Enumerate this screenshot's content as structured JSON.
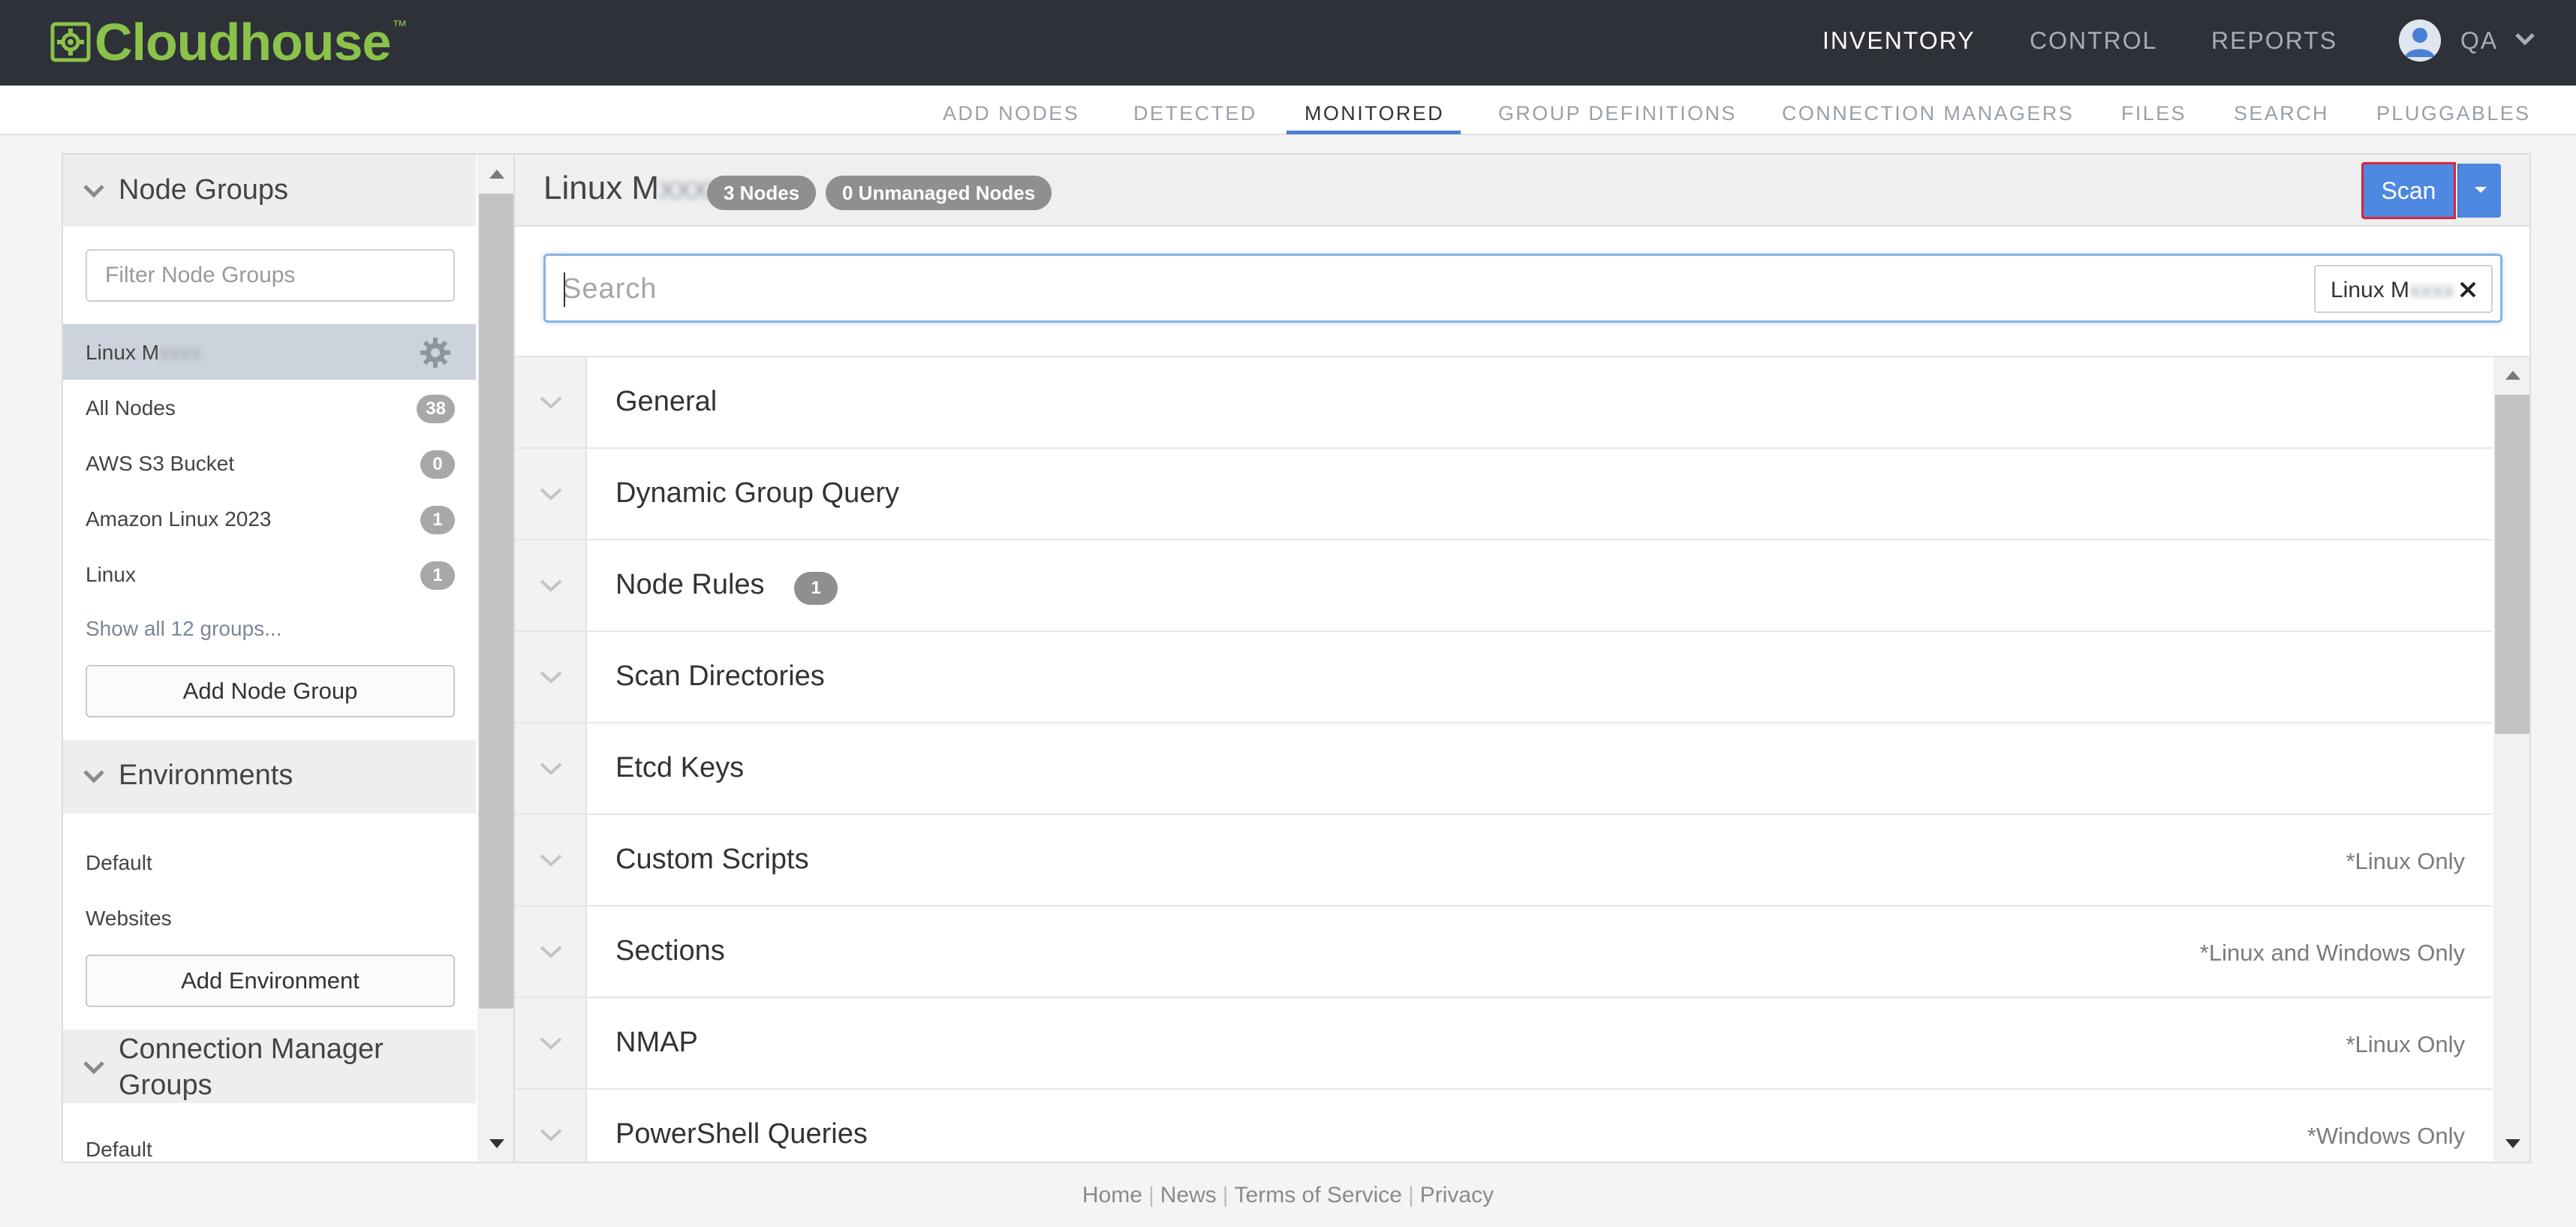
{
  "brand": {
    "name": "Cloudhouse",
    "tm": "™",
    "color": "#8bc34a"
  },
  "main_nav": {
    "items": [
      "INVENTORY",
      "CONTROL",
      "REPORTS"
    ],
    "active": "INVENTORY",
    "user_label": "QA"
  },
  "sub_nav": {
    "items": [
      "ADD NODES",
      "DETECTED",
      "MONITORED",
      "GROUP DEFINITIONS",
      "CONNECTION MANAGERS",
      "FILES",
      "SEARCH",
      "PLUGGABLES"
    ],
    "active": "MONITORED",
    "accent": "#4a7fd6"
  },
  "sidebar": {
    "node_groups": {
      "heading": "Node Groups",
      "filter_placeholder": "Filter Node Groups",
      "selected": {
        "label_visible": "Linux M",
        "label_blurred": "xxxx"
      },
      "items": [
        {
          "label": "All Nodes",
          "count": "38"
        },
        {
          "label": "AWS S3 Bucket",
          "count": "0"
        },
        {
          "label": "Amazon Linux 2023",
          "count": "1"
        },
        {
          "label": "Linux",
          "count": "1"
        }
      ],
      "show_all": "Show all 12 groups...",
      "add_button": "Add Node Group"
    },
    "environments": {
      "heading": "Environments",
      "items": [
        "Default",
        "Websites"
      ],
      "add_button": "Add Environment"
    },
    "connection_manager_groups": {
      "heading_line1": "Connection Manager",
      "heading_line2": "Groups",
      "items": [
        "Default"
      ]
    }
  },
  "main": {
    "title_visible": "Linux M",
    "title_blurred": "xxxx",
    "nodes_pill": "3 Nodes",
    "unmanaged_pill": "0 Unmanaged Nodes",
    "scan_button": "Scan",
    "search_placeholder": "Search",
    "chip_visible": "Linux M",
    "chip_blurred": "xxxx",
    "sections": [
      {
        "title": "General",
        "note": "",
        "badge": ""
      },
      {
        "title": "Dynamic Group Query",
        "note": "",
        "badge": ""
      },
      {
        "title": "Node Rules",
        "note": "",
        "badge": "1"
      },
      {
        "title": "Scan Directories",
        "note": "",
        "badge": ""
      },
      {
        "title": "Etcd Keys",
        "note": "",
        "badge": ""
      },
      {
        "title": "Custom Scripts",
        "note": "*Linux Only",
        "badge": ""
      },
      {
        "title": "Sections",
        "note": "*Linux and Windows Only",
        "badge": ""
      },
      {
        "title": "NMAP",
        "note": "*Linux Only",
        "badge": ""
      },
      {
        "title": "PowerShell Queries",
        "note": "*Windows Only",
        "badge": ""
      }
    ]
  },
  "footer": {
    "links": [
      "Home",
      "News",
      "Terms of Service",
      "Privacy"
    ],
    "separator": "|"
  },
  "colors": {
    "topbar": "#2e3138",
    "scan_button": "#4e88e0",
    "scan_highlight": "#e0233a"
  }
}
